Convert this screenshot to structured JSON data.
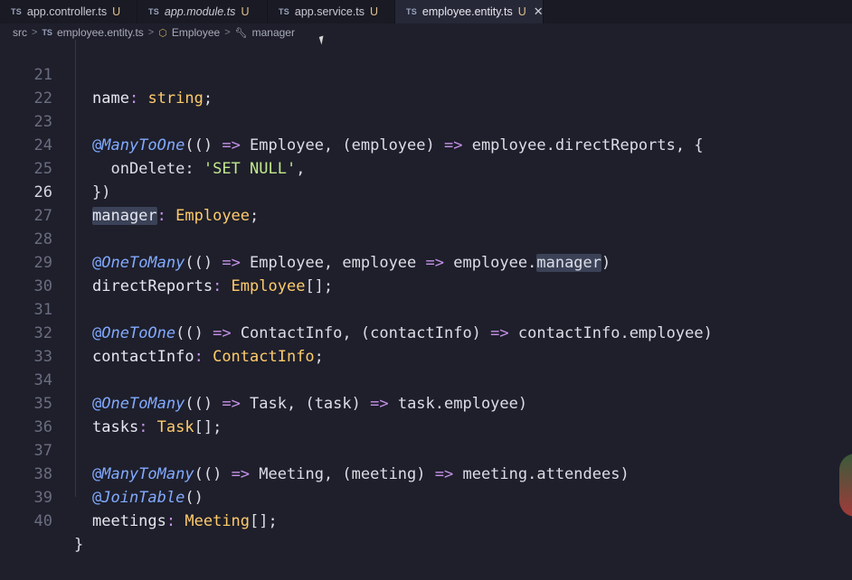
{
  "tabs": [
    {
      "label": "app.controller.ts",
      "status": "U",
      "italic": false,
      "active": false
    },
    {
      "label": "app.module.ts",
      "status": "U",
      "italic": true,
      "active": false
    },
    {
      "label": "app.service.ts",
      "status": "U",
      "italic": false,
      "active": false
    },
    {
      "label": "employee.entity.ts",
      "status": "U",
      "italic": false,
      "active": true
    }
  ],
  "file_badge": "TS",
  "close_glyph": "✕",
  "breadcrumb": {
    "folder": "src",
    "file": "employee.entity.ts",
    "class": "Employee",
    "member": "manager",
    "sep": ">"
  },
  "line_numbers": [
    "21",
    "22",
    "23",
    "24",
    "25",
    "26",
    "27",
    "28",
    "29",
    "30",
    "31",
    "32",
    "33",
    "34",
    "35",
    "36",
    "37",
    "38",
    "39",
    "40"
  ],
  "code": {
    "l21": {
      "name": "name",
      "colon": ":",
      "type": "string",
      "semi": ";"
    },
    "l23": {
      "at": "@",
      "dec": "ManyToOne",
      "open": "(() ",
      "arrow": "=>",
      "t1": " Employee, (employee) ",
      "arrow2": "=>",
      "t2": " employee.directReports, {"
    },
    "l24": {
      "key": "  onDelete",
      "colon": ": ",
      "str": "'SET NULL'",
      "tail": ","
    },
    "l25": {
      "text": "})"
    },
    "l26": {
      "name": "manager",
      "colon": ":",
      "type": " Employee",
      "semi": ";"
    },
    "l28": {
      "at": "@",
      "dec": "OneToMany",
      "open": "(() ",
      "arrow": "=>",
      "t1": " Employee, employee ",
      "arrow2": "=>",
      "t2": " employee.",
      "hl": "manager",
      "tail": ")"
    },
    "l29": {
      "name": "directReports",
      "colon": ":",
      "type": " Employee",
      "tail": "[];"
    },
    "l31": {
      "at": "@",
      "dec": "OneToOne",
      "open": "(() ",
      "arrow": "=>",
      "t1": " ContactInfo, (contactInfo) ",
      "arrow2": "=>",
      "t2": " contactInfo.employee)"
    },
    "l32": {
      "name": "contactInfo",
      "colon": ":",
      "type": " ContactInfo",
      "semi": ";"
    },
    "l34": {
      "at": "@",
      "dec": "OneToMany",
      "open": "(() ",
      "arrow": "=>",
      "t1": " Task, (task) ",
      "arrow2": "=>",
      "t2": " task.employee)"
    },
    "l35": {
      "name": "tasks",
      "colon": ":",
      "type": " Task",
      "tail": "[];"
    },
    "l37": {
      "at": "@",
      "dec": "ManyToMany",
      "open": "(() ",
      "arrow": "=>",
      "t1": " Meeting, (meeting) ",
      "arrow2": "=>",
      "t2": " meeting.attendees)"
    },
    "l38": {
      "at": "@",
      "dec": "JoinTable",
      "tail": "()"
    },
    "l39": {
      "name": "meetings",
      "colon": ":",
      "type": " Meeting",
      "tail": "[];"
    },
    "l40": {
      "text": "}"
    }
  },
  "current_line": "26",
  "colors": {
    "accent": "#82aaff",
    "keyword": "#c792ea",
    "type": "#ffcb6b",
    "string": "#c3e88d",
    "background": "#1e1f2b"
  }
}
